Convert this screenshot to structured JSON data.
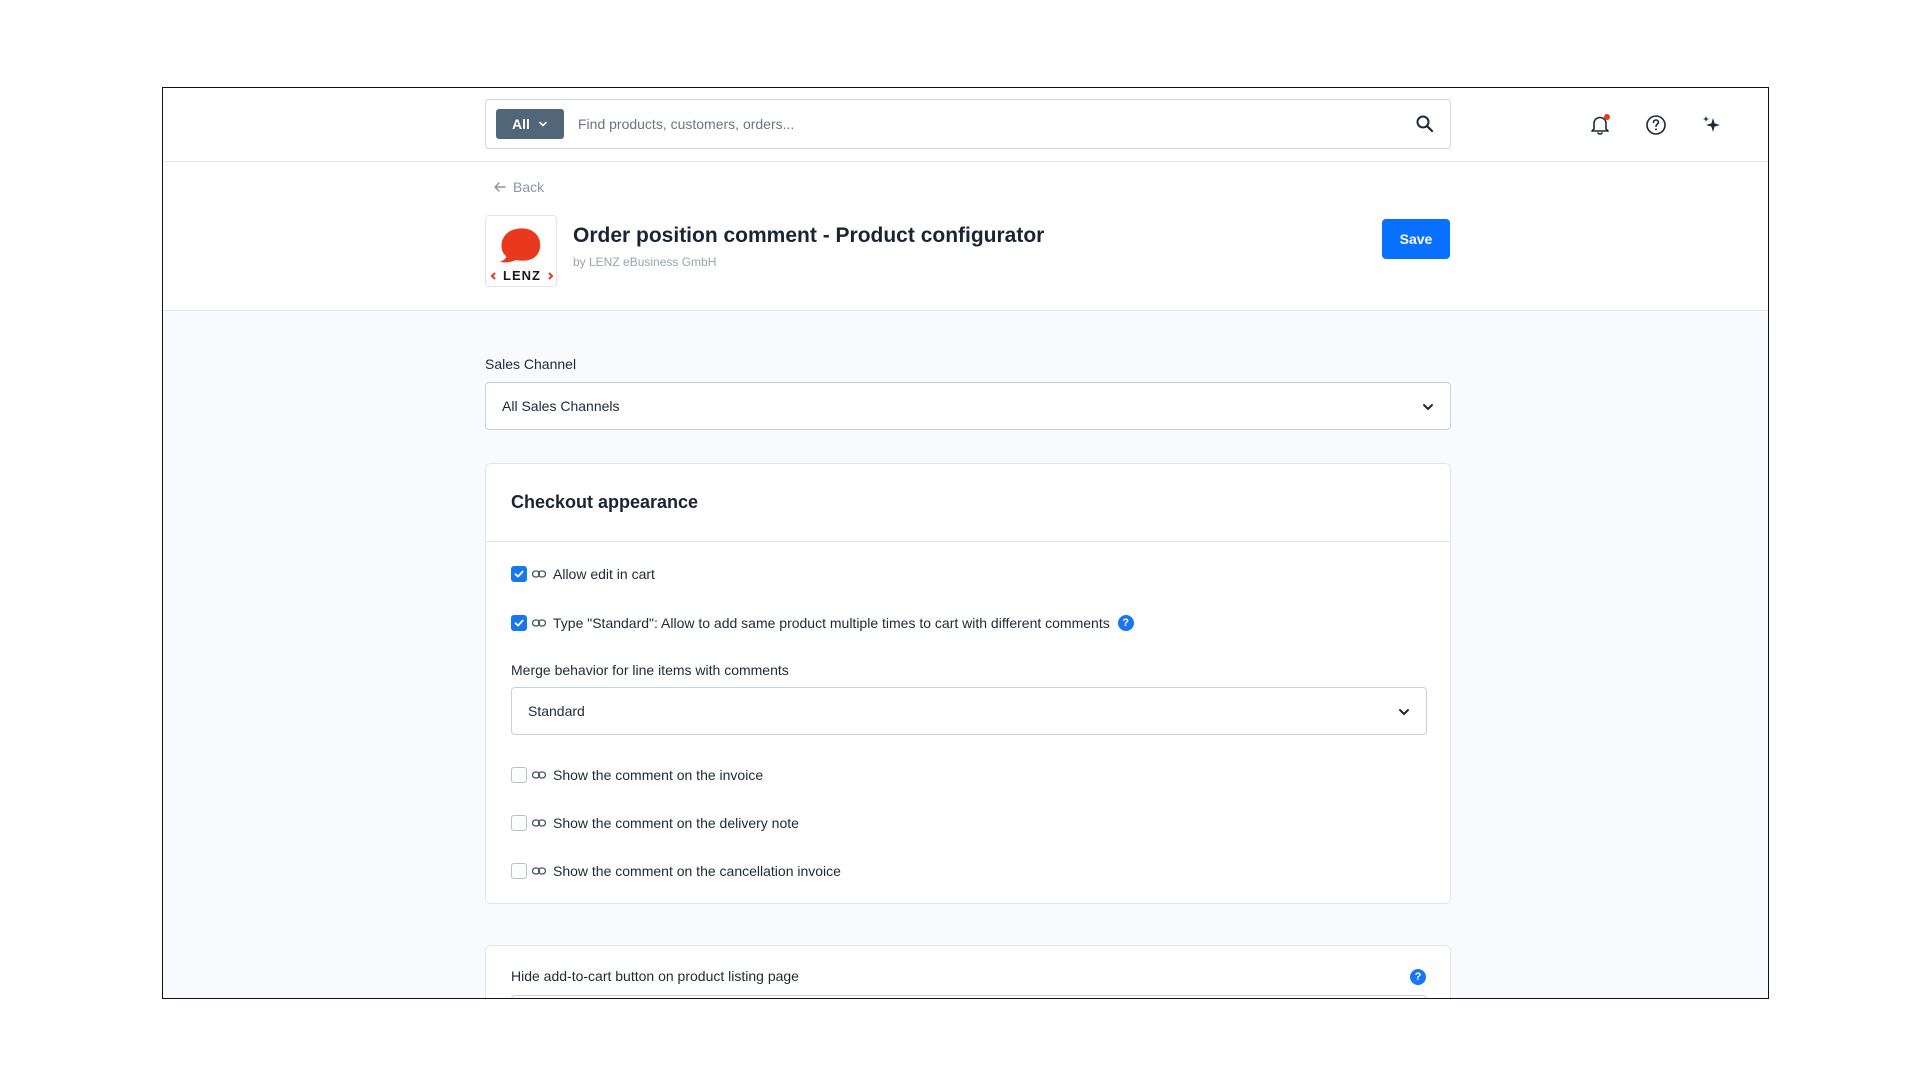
{
  "search": {
    "type_label": "All",
    "placeholder": "Find products, customers, orders..."
  },
  "header_icons": [
    "bell-icon",
    "question-circle-icon",
    "sparkles-icon"
  ],
  "colors": {
    "primary": "#0870ff",
    "checkbox": "#1976f2",
    "search_type_bg": "#52667a",
    "notification_dot": "#e8391f",
    "logo_red": "#e8391f"
  },
  "page": {
    "back_label": "Back",
    "title": "Order position comment - Product configurator",
    "author": "by LENZ eBusiness GmbH",
    "logo_text": "LENZ",
    "save_label": "Save"
  },
  "sales_channel": {
    "label": "Sales Channel",
    "value": "All Sales Channels"
  },
  "checkout_card": {
    "title": "Checkout appearance",
    "options": [
      {
        "label": "Allow edit in cart",
        "checked": true
      },
      {
        "label": "Type \"Standard\": Allow to add same product multiple times to cart with different comments",
        "checked": true,
        "help": "?"
      }
    ],
    "merge": {
      "label": "Merge behavior for line items with comments",
      "value": "Standard"
    },
    "doc_options": [
      {
        "label": "Show the comment on the invoice",
        "checked": false
      },
      {
        "label": "Show the comment on the delivery note",
        "checked": false
      },
      {
        "label": "Show the comment on the cancellation invoice",
        "checked": false
      }
    ]
  },
  "listing_card": {
    "label": "Hide add-to-cart button on product listing page",
    "help": "?"
  }
}
